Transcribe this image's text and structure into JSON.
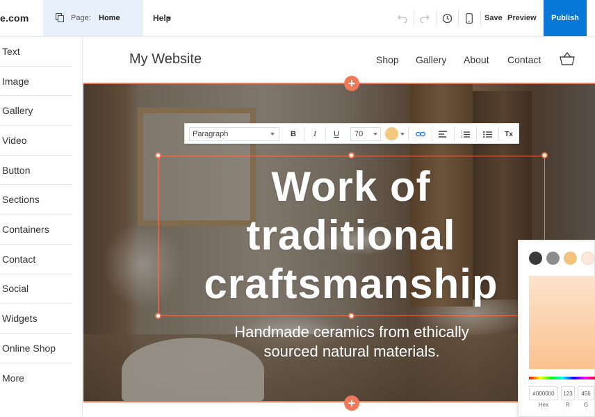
{
  "topbar": {
    "brand": "e.com",
    "page_label": "Page:",
    "page_value": "Home",
    "help_label": "Help",
    "save_label": "Save",
    "preview_label": "Preview",
    "publish_label": "Publish",
    "publish_color": "#0878d8"
  },
  "sidebar": {
    "items": [
      "Text",
      "Image",
      "Gallery",
      "Video",
      "Button",
      "Sections",
      "Containers",
      "Contact",
      "Social",
      "Widgets",
      "Online Shop",
      "More"
    ]
  },
  "site": {
    "title": "My Website",
    "nav": [
      "Shop",
      "Gallery",
      "About",
      "Contact"
    ]
  },
  "hero": {
    "heading": "Work of\ntraditional\ncraftsmanship",
    "subheading": "Handmade ceramics from ethically\nsourced natural materials."
  },
  "text_toolbar": {
    "style_value": "Paragraph",
    "bold": "B",
    "italic": "I",
    "underline": "U",
    "font_size": "70",
    "clear_format": "Tx",
    "text_color": "#f4c97f"
  },
  "color_picker": {
    "presets": [
      "#3a3a3a",
      "#8c8c8c",
      "#f4c37f",
      "#fde9dc"
    ],
    "hex_value": "#000000",
    "r_value": "123",
    "g_value": "456",
    "hex_label": "Hex",
    "r_label": "R",
    "g_label": "G"
  },
  "accent_color": "#f0795a"
}
